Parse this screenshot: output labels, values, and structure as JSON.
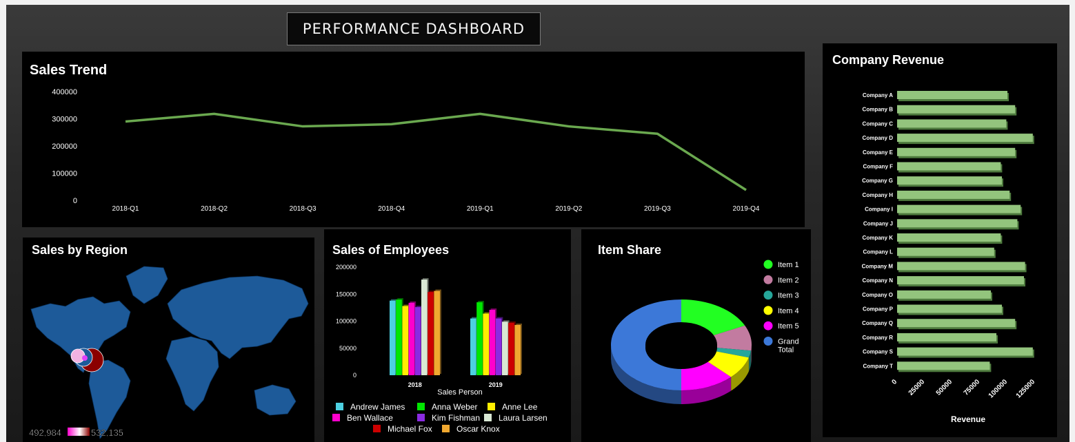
{
  "dashboard_title": "PERFORMANCE DASHBOARD",
  "chart_data": [
    {
      "type": "line",
      "title": "Sales Trend",
      "categories": [
        "2018-Q1",
        "2018-Q2",
        "2018-Q3",
        "2018-Q4",
        "2019-Q1",
        "2019-Q2",
        "2019-Q3",
        "2019-Q4"
      ],
      "values": [
        290000,
        318000,
        272000,
        280000,
        318000,
        272000,
        245000,
        38000
      ],
      "yticks": [
        "400000",
        "300000",
        "200000",
        "100000",
        "0"
      ],
      "ylim": [
        0,
        400000
      ],
      "color": "#6aa84f"
    },
    {
      "type": "map",
      "title": "Sales by Region",
      "scale_min": "492,984",
      "scale_max": "532,135",
      "colors": {
        "land": "#1d5a99",
        "bubble_low": "#f3b2e2",
        "bubble_high": "#8b0000"
      }
    },
    {
      "type": "bar",
      "title": "Sales of Employees",
      "xlabel": "Sales Person",
      "categories": [
        "2018",
        "2019"
      ],
      "yticks": [
        "200000",
        "150000",
        "100000",
        "50000",
        "0"
      ],
      "ylim": [
        0,
        200000
      ],
      "series": [
        {
          "name": "Andrew James",
          "color": "#4dd0e1",
          "values": [
            138000,
            105000
          ]
        },
        {
          "name": "Anna Weber",
          "color": "#00e600",
          "values": [
            140000,
            135000
          ]
        },
        {
          "name": "Anne Lee",
          "color": "#ffee00",
          "values": [
            128000,
            114000
          ]
        },
        {
          "name": "Ben Wallace",
          "color": "#ff00cc",
          "values": [
            134000,
            121000
          ]
        },
        {
          "name": "Kim Fishman",
          "color": "#8a2be2",
          "values": [
            126000,
            105000
          ]
        },
        {
          "name": "Laura Larsen",
          "color": "#d9e8d4",
          "values": [
            177000,
            99000
          ]
        },
        {
          "name": "Michael Fox",
          "color": "#cc0000",
          "values": [
            154000,
            97000
          ]
        },
        {
          "name": "Oscar Knox",
          "color": "#f0a830",
          "values": [
            156000,
            93000
          ]
        }
      ]
    },
    {
      "type": "pie",
      "title": "Item Share",
      "slices": [
        {
          "label": "Item 1",
          "value": 18,
          "color": "#22ff22"
        },
        {
          "label": "Item 2",
          "value": 9,
          "color": "#c27ba0"
        },
        {
          "label": "Item 3",
          "value": 2.5,
          "color": "#26a69a"
        },
        {
          "label": "Item 4",
          "value": 8,
          "color": "#ffff00"
        },
        {
          "label": "Item 5",
          "value": 12.5,
          "color": "#ff00ff"
        },
        {
          "label": "Grand Total",
          "value": 50,
          "color": "#3c78d8"
        }
      ]
    },
    {
      "type": "bar",
      "orientation": "horizontal",
      "title": "Company Revenue",
      "xlabel": "Revenue",
      "xticks": [
        "0",
        "25000",
        "50000",
        "75000",
        "100000",
        "125000"
      ],
      "xlim": [
        0,
        125000
      ],
      "color": "#93c47d",
      "categories": [
        "Company A",
        "Company B",
        "Company C",
        "Company D",
        "Company E",
        "Company F",
        "Company G",
        "Company H",
        "Company I",
        "Company J",
        "Company K",
        "Company L",
        "Company M",
        "Company N",
        "Company O",
        "Company P",
        "Company Q",
        "Company R",
        "Company S",
        "Company T"
      ],
      "values": [
        100000,
        107000,
        99000,
        123000,
        107000,
        94000,
        95000,
        102000,
        112000,
        109000,
        94000,
        88000,
        116000,
        115000,
        85000,
        95000,
        107000,
        90000,
        123000,
        84000
      ]
    }
  ]
}
